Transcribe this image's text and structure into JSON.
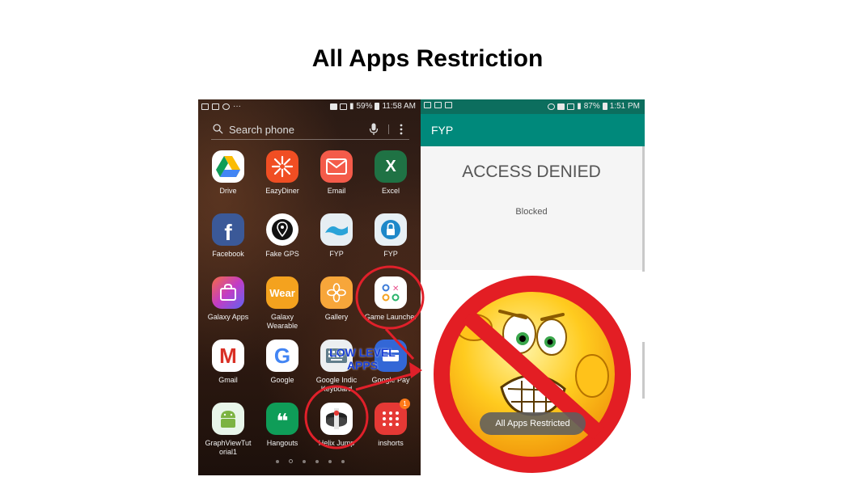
{
  "slide": {
    "title": "All Apps Restriction"
  },
  "left_phone": {
    "status_bar": {
      "time": "11:58 AM",
      "battery": "59%",
      "left_dots": "···"
    },
    "search": {
      "placeholder": "Search phone"
    },
    "apps": [
      {
        "label": "Drive",
        "icon": "google-drive-icon"
      },
      {
        "label": "EazyDiner",
        "icon": "eazydiner-icon"
      },
      {
        "label": "Email",
        "icon": "email-icon"
      },
      {
        "label": "Excel",
        "icon": "excel-icon",
        "icon_text": "X"
      },
      {
        "label": "Facebook",
        "icon": "facebook-icon",
        "icon_text": "f"
      },
      {
        "label": "Fake GPS",
        "icon": "fake-gps-icon"
      },
      {
        "label": "FYP",
        "icon": "fyp-wave-icon"
      },
      {
        "label": "FYP",
        "icon": "fyp-lock-icon"
      },
      {
        "label": "Galaxy Apps",
        "icon": "galaxy-apps-icon"
      },
      {
        "label": "Galaxy\nWearable",
        "icon": "galaxy-wearable-icon",
        "icon_text": "Wear"
      },
      {
        "label": "Gallery",
        "icon": "gallery-icon"
      },
      {
        "label": "Game Launcher",
        "icon": "game-launcher-icon"
      },
      {
        "label": "Gmail",
        "icon": "gmail-icon",
        "icon_text": "M"
      },
      {
        "label": "Google",
        "icon": "google-icon",
        "icon_text": "G"
      },
      {
        "label": "Google Indic\nKeyboard",
        "icon": "indic-keyboard-icon"
      },
      {
        "label": "Google Pay",
        "icon": "google-pay-icon"
      },
      {
        "label": "GraphViewTut\norial1",
        "icon": "android-icon"
      },
      {
        "label": "Hangouts",
        "icon": "hangouts-icon",
        "icon_text": "❝"
      },
      {
        "label": "Helix Jump",
        "icon": "helix-jump-icon"
      },
      {
        "label": "inshorts",
        "icon": "inshorts-icon",
        "badge": "1"
      }
    ]
  },
  "right_phone": {
    "status_bar": {
      "time": "1:51 PM",
      "battery": "87%"
    },
    "app_bar_title": "FYP",
    "heading": "ACCESS DENIED",
    "status_text": "Blocked",
    "toast": "All Apps Restricted"
  },
  "annotation": {
    "text": "LOW LEVEL\nAPPS"
  },
  "colors": {
    "app_bar": "#00897b",
    "status_bar_right": "#0c6e5e",
    "highlight_circle": "#e0202a",
    "annotation_text": "#1a3fd6",
    "prohibition_sign": "#e31e24"
  }
}
